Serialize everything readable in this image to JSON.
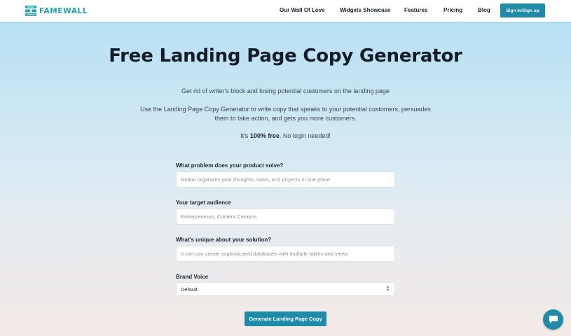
{
  "nav": {
    "logo_text": "FAMEWALL",
    "links": [
      "Our Wall Of Love",
      "Widgets Showcase",
      "Features",
      "Pricing",
      "Blog"
    ],
    "signin_label": "Sign in/Sign up"
  },
  "hero": {
    "title": "Free Landing Page Copy Generator",
    "desc1": "Get rid of writer's block and losing potential customers on the landing page",
    "desc2_line1": "Use the Landing Page Copy Generator to write copy that speaks to your potential customers, persuades",
    "desc2_line2": "them to take action, and gets you more customers.",
    "free_prefix": "It's ",
    "free_bold": "100% free",
    "free_suffix": ". No login needed!"
  },
  "form": {
    "problem_label": "What problem does your product solve?",
    "problem_placeholder": "Notion organizes your thoughts, tasks, and projects in one place",
    "audience_label": "Your target audience",
    "audience_placeholder": "Entrepreneurs, Content Creators",
    "unique_label": "What's unique about your solution?",
    "unique_placeholder": "It can can create sophisticated databases with multiple tables and views",
    "voice_label": "Brand Voice",
    "voice_value": "Default",
    "generate_label": "Generate Landing Page Copy"
  },
  "colors": {
    "accent": "#1f8ba6",
    "logo": "#23a3ad"
  },
  "icons": {
    "logo": "famewall-logo-icon",
    "select": "chevron-updown-icon",
    "chat": "chat-icon"
  }
}
